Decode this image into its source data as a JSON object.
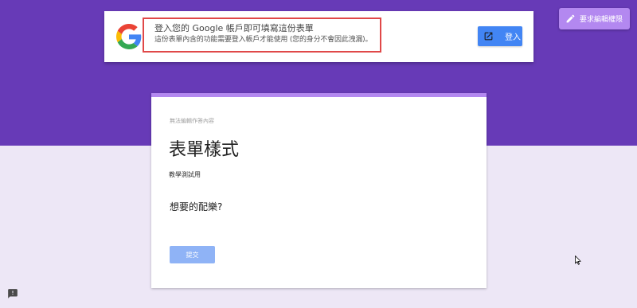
{
  "signin_bar": {
    "title": "登入您的 Google 帳戶即可填寫這份表單",
    "subtitle": "這份表單內含的功能需要登入帳戶才能使用 (您的身分不會因此洩漏)。",
    "button_label": "登入",
    "button_icon": "open-in-new-icon",
    "highlight_color": "#e04848"
  },
  "request_edit": {
    "label": "要求編輯權限",
    "icon": "pencil-icon"
  },
  "form": {
    "notice": "無法編輯作答內容",
    "title": "表單樣式",
    "description": "教學測試用",
    "question": "想要的配樂?",
    "submit_label": "提交"
  },
  "colors": {
    "theme_purple": "#673ab7",
    "background": "#ede7f6",
    "accent_light_purple": "#b388f0",
    "google_blue": "#4285f4"
  }
}
